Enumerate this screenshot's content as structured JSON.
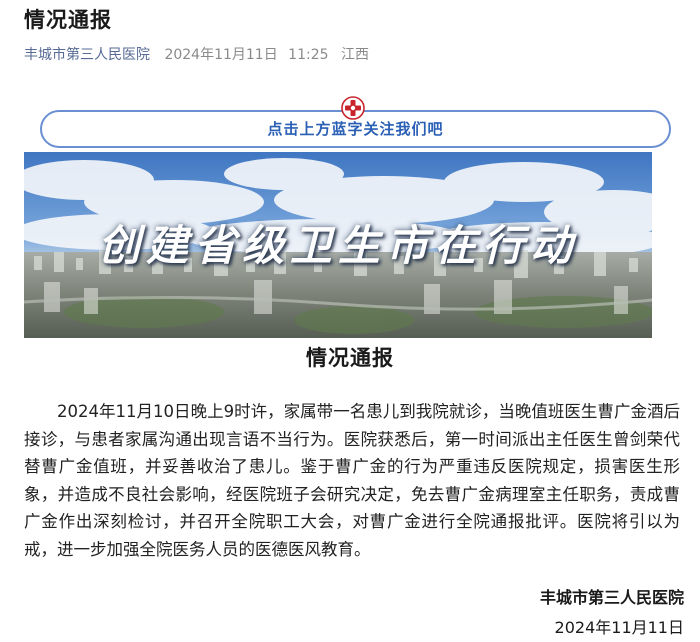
{
  "article": {
    "title": "情况通报",
    "account_name": "丰城市第三人民医院",
    "publish_date": "2024年11月11日",
    "publish_time": "11:25",
    "location": "江西"
  },
  "follow_banner": {
    "text": "点击上方蓝字关注我们吧",
    "logo_icon": "red-cross-hospital-logo-icon"
  },
  "hero_banner": {
    "slogan": "创建省级卫生市在行动",
    "colors": {
      "sky": "#5b8fd0",
      "cloud": "#f2f5f9",
      "city": "#8a8f86"
    }
  },
  "notice": {
    "heading": "情况通报",
    "body": "2024年11月10日晚上9时许，家属带一名患儿到我院就诊，当晚值班医生曹广金酒后接诊，与患者家属沟通出现言语不当行为。医院获悉后，第一时间派出主任医生曾剑荣代替曹广金值班，并妥善收治了患儿。鉴于曹广金的行为严重违反医院规定，损害医生形象，并造成不良社会影响，经医院班子会研究决定，免去曹广金病理室主任职务，责成曹广金作出深刻检讨，并召开全院职工大会，对曹广金进行全院通报批评。医院将引以为戒，进一步加强全院医务人员的医德医风教育。",
    "signature": "丰城市第三人民医院",
    "date": "2024年11月11日"
  }
}
